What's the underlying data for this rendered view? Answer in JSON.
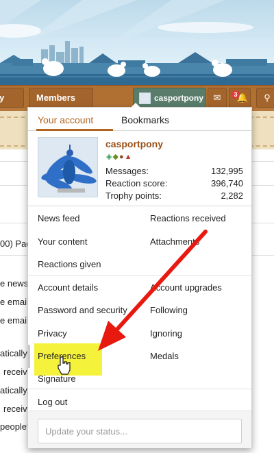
{
  "nav": {
    "left_tab_label": "y",
    "members_label": "Members",
    "username": "casportpony",
    "notification_count": "3"
  },
  "dropdown": {
    "tabs": [
      {
        "label": "Your account"
      },
      {
        "label": "Bookmarks"
      }
    ],
    "profile": {
      "username": "casportpony",
      "stats": [
        {
          "label": "Messages:",
          "value": "132,995"
        },
        {
          "label": "Reaction score:",
          "value": "396,740"
        },
        {
          "label": "Trophy points:",
          "value": "2,282"
        }
      ]
    },
    "menu": {
      "news_feed": "News feed",
      "reactions_received": "Reactions received",
      "your_content": "Your content",
      "attachments": "Attachments",
      "reactions_given": "Reactions given",
      "account_details": "Account details",
      "account_upgrades": "Account upgrades",
      "password_security": "Password and security",
      "following": "Following",
      "privacy": "Privacy",
      "ignoring": "Ignoring",
      "preferences": "Preferences",
      "medals": "Medals",
      "signature": "Signature",
      "log_out": "Log out"
    },
    "status_placeholder": "Update your status..."
  },
  "background": {
    "line_pac": "00) Pac",
    "line_news": "e news",
    "line_email1": "e email",
    "line_email2": "e email",
    "line_atically1": "atically",
    "line_receiv1": "receiv",
    "line_atically2": "atically",
    "line_receiv2": "receiv",
    "line_people": "people'"
  },
  "colors": {
    "nav_brown": "#b07032",
    "user_tab_green": "#597c6b",
    "accent_orange": "#b3651f",
    "username_brown": "#9a5018",
    "highlight_yellow": "#f5f23c",
    "arrow_red": "#e8190f"
  }
}
